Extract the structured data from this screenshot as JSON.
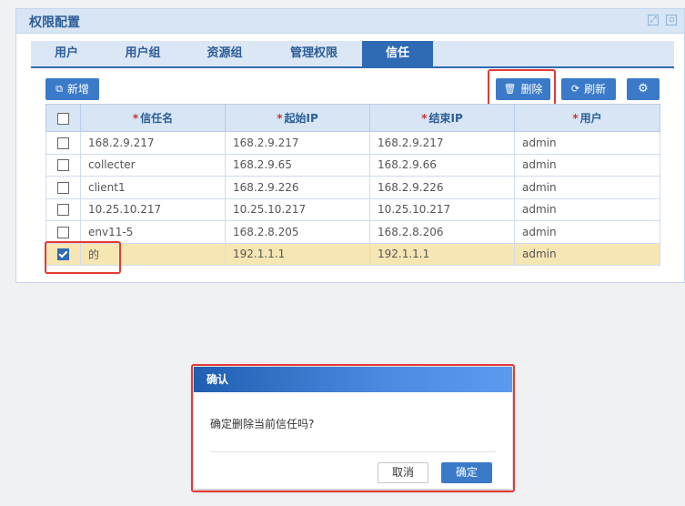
{
  "panel": {
    "title": "权限配置"
  },
  "tabs": [
    {
      "label": "用户",
      "active": false
    },
    {
      "label": "用户组",
      "active": false
    },
    {
      "label": "资源组",
      "active": false
    },
    {
      "label": "管理权限",
      "active": false
    },
    {
      "label": "信任",
      "active": true
    }
  ],
  "toolbar": {
    "add_label": "新增",
    "delete_label": "删除",
    "refresh_label": "刷新"
  },
  "table": {
    "required_mark": "*",
    "headers": [
      "信任名",
      "起始IP",
      "结束IP",
      "用户"
    ],
    "rows": [
      {
        "name": "168.2.9.217",
        "start_ip": "168.2.9.217",
        "end_ip": "168.2.9.217",
        "user": "admin",
        "checked": false
      },
      {
        "name": "collecter",
        "start_ip": "168.2.9.65",
        "end_ip": "168.2.9.66",
        "user": "admin",
        "checked": false
      },
      {
        "name": "client1",
        "start_ip": "168.2.9.226",
        "end_ip": "168.2.9.226",
        "user": "admin",
        "checked": false
      },
      {
        "name": "10.25.10.217",
        "start_ip": "10.25.10.217",
        "end_ip": "10.25.10.217",
        "user": "admin",
        "checked": false
      },
      {
        "name": "env11-5",
        "start_ip": "168.2.8.205",
        "end_ip": "168.2.8.206",
        "user": "admin",
        "checked": false
      },
      {
        "name": "的",
        "start_ip": "192.1.1.1",
        "end_ip": "192.1.1.1",
        "user": "admin",
        "checked": true
      }
    ]
  },
  "dialog": {
    "title": "确认",
    "message": "确定删除当前信任吗?",
    "cancel_label": "取消",
    "ok_label": "确定"
  },
  "colors": {
    "accent": "#2f6ab5",
    "button": "#3a7ac9",
    "selected_row": "#f6e6b3",
    "highlight": "#e53935"
  },
  "icons": {
    "add": "copy-icon",
    "delete": "trash-icon",
    "refresh": "refresh-icon",
    "settings": "gear-icon"
  }
}
